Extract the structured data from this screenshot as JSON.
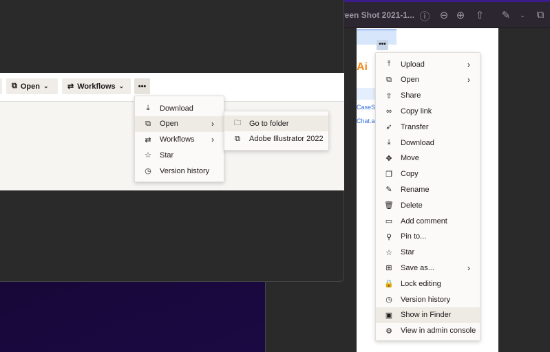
{
  "preview": {
    "title": "reen Shot 2021-1...",
    "toolbar_icons": [
      "info-icon",
      "zoom-out-icon",
      "zoom-in-icon",
      "share-icon",
      "markup-pen-icon",
      "chevron-down-icon",
      "rotate-icon"
    ],
    "page": {
      "ai_label": "Ai",
      "more_label": "•••",
      "links": [
        "CaseS.",
        "Chat.ai"
      ]
    }
  },
  "toolbar": {
    "open_label": "Open",
    "workflows_label": "Workflows",
    "more_label": "•••"
  },
  "context_menu": {
    "items": [
      {
        "label": "Download",
        "icon": "download-icon"
      },
      {
        "label": "Open",
        "icon": "open-external-icon",
        "submenu": true,
        "highlighted": true
      },
      {
        "label": "Workflows",
        "icon": "workflows-icon",
        "submenu": true
      },
      {
        "label": "Star",
        "icon": "star-icon"
      },
      {
        "label": "Version history",
        "icon": "clock-icon"
      }
    ]
  },
  "open_submenu": {
    "items": [
      {
        "label": "Go to folder",
        "icon": "folder-search-icon",
        "highlighted": true
      },
      {
        "label": "Adobe Illustrator 2022",
        "icon": "open-external-icon"
      }
    ]
  },
  "right_menu": {
    "items": [
      {
        "label": "Upload",
        "icon": "upload-icon",
        "submenu": true
      },
      {
        "label": "Open",
        "icon": "open-external-icon",
        "submenu": true
      },
      {
        "label": "Share",
        "icon": "share-icon"
      },
      {
        "label": "Copy link",
        "icon": "link-icon"
      },
      {
        "label": "Transfer",
        "icon": "transfer-icon"
      },
      {
        "label": "Download",
        "icon": "download-icon"
      },
      {
        "label": "Move",
        "icon": "move-icon"
      },
      {
        "label": "Copy",
        "icon": "copy-icon"
      },
      {
        "label": "Rename",
        "icon": "pencil-icon"
      },
      {
        "label": "Delete",
        "icon": "trash-icon"
      },
      {
        "label": "Add comment",
        "icon": "comment-icon"
      },
      {
        "label": "Pin to...",
        "icon": "pin-icon"
      },
      {
        "label": "Star",
        "icon": "star-icon"
      },
      {
        "label": "Save as...",
        "icon": "save-as-icon",
        "submenu": true
      },
      {
        "label": "Lock editing",
        "icon": "lock-icon"
      },
      {
        "label": "Version history",
        "icon": "clock-icon"
      },
      {
        "label": "Show in Finder",
        "icon": "finder-icon",
        "highlighted": true
      },
      {
        "label": "View in admin console",
        "icon": "gear-icon"
      }
    ]
  }
}
